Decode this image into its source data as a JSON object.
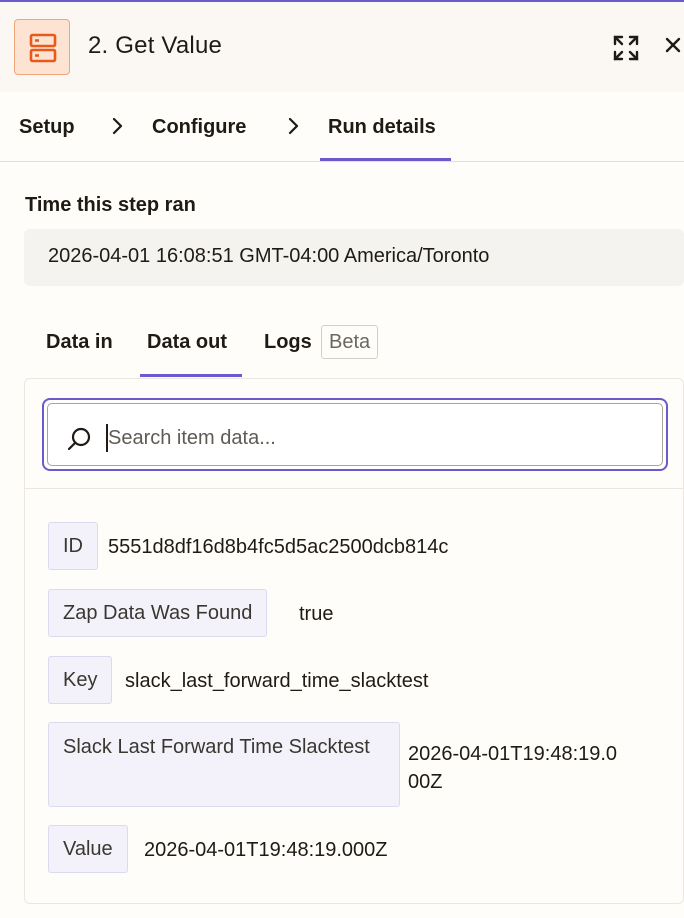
{
  "header": {
    "app_icon": "storage-icon",
    "title": "2. Get Value",
    "expand_icon": "expand-icon",
    "close_icon": "close-icon",
    "close_glyph": "✕"
  },
  "steps": [
    {
      "label": "Setup"
    },
    {
      "label": "Configure"
    },
    {
      "label": "Run details",
      "active": true
    }
  ],
  "time_section": {
    "label": "Time this step ran",
    "value": "2026-04-01 16:08:51 GMT-04:00 America/Toronto"
  },
  "data_tabs": [
    {
      "label": "Data in"
    },
    {
      "label": "Data out",
      "active": true
    },
    {
      "label": "Logs",
      "badge": "Beta"
    }
  ],
  "search": {
    "placeholder": "Search item data...",
    "icon": "search-icon"
  },
  "fields": [
    {
      "key": "ID",
      "value": "5551d8df16d8b4fc5d5ac2500dcb814c"
    },
    {
      "key": "Zap Data Was Found",
      "value": "true"
    },
    {
      "key": "Key",
      "value": "slack_last_forward_time_slacktest"
    },
    {
      "key": "Slack Last Forward Time Slacktest",
      "value": "2026-04-01T19:48:19.000Z"
    },
    {
      "key": "Value",
      "value": "2026-04-01T19:48:19.000Z"
    }
  ],
  "colors": {
    "accent": "#6a5acd",
    "app_icon_bg": "#fde3d2",
    "app_icon_fg": "#e8591a",
    "field_key_bg": "#f3f2fb"
  }
}
